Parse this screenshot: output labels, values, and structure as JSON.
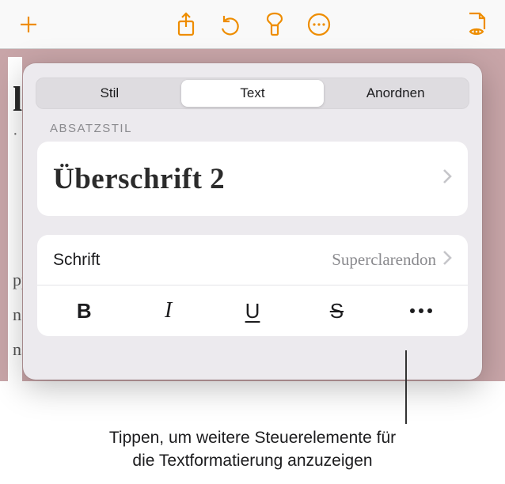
{
  "toolbar": {
    "add_icon": "plus",
    "share_icon": "share",
    "undo_icon": "undo",
    "format_icon": "brush",
    "more_icon": "ellipsis-circle",
    "readmode_icon": "document-eye"
  },
  "doc": {
    "heading_fragment": "lo",
    "body_fragment_1": "pp",
    "body_fragment_2": "n y",
    "body_fragment_3": "ns"
  },
  "popover": {
    "tabs": {
      "style": "Stil",
      "text": "Text",
      "arrange": "Anordnen"
    },
    "section_label": "ABSATZSTIL",
    "paragraph_style": "Überschrift 2",
    "font_label": "Schrift",
    "font_value": "Superclarendon",
    "styles": {
      "bold": "B",
      "italic": "I",
      "underline": "U",
      "strike": "S"
    }
  },
  "caption": {
    "line1": "Tippen, um weitere Steuerelemente für",
    "line2": "die Textformatierung anzuzeigen"
  }
}
